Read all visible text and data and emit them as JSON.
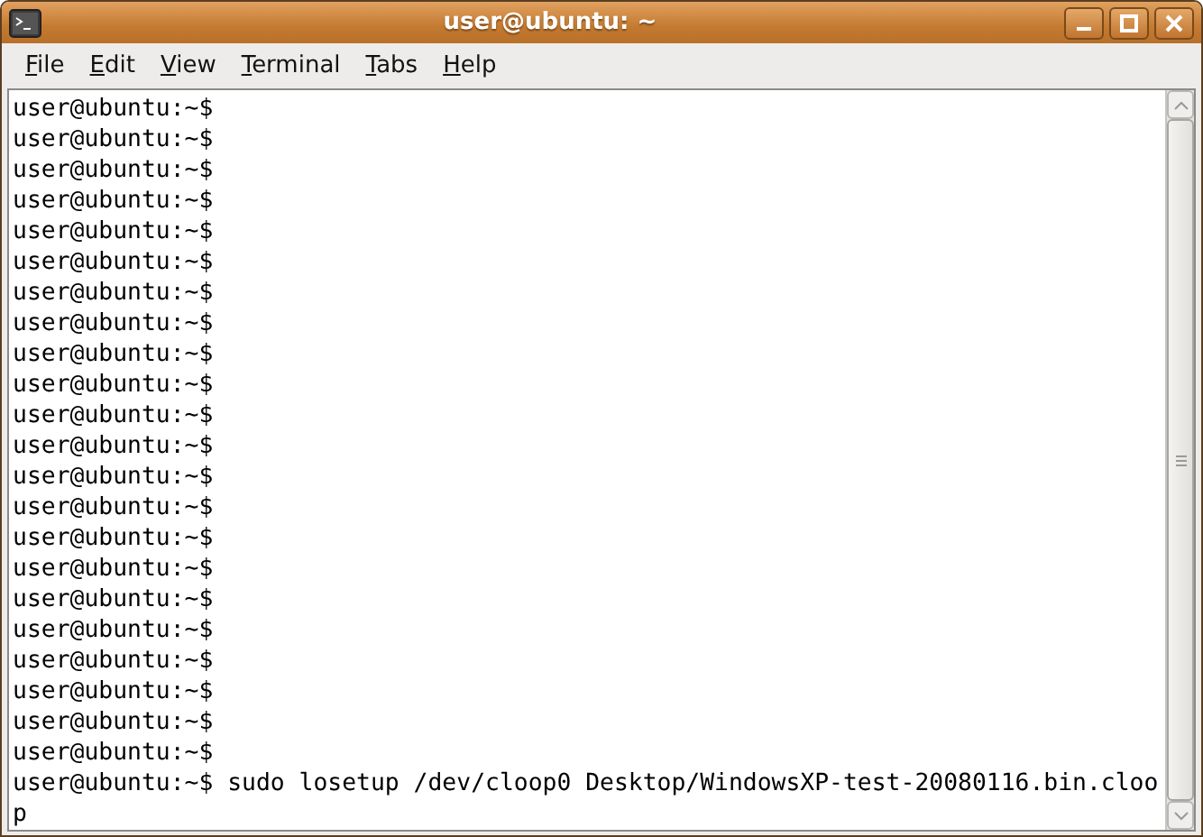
{
  "window": {
    "title": "user@ubuntu: ~"
  },
  "menu": [
    {
      "label": "File",
      "underlined": true
    },
    {
      "label": "Edit",
      "underlined": true
    },
    {
      "label": "View",
      "underlined": true
    },
    {
      "label": "Terminal",
      "underlined": true
    },
    {
      "label": "Tabs",
      "underlined": true
    },
    {
      "label": "Help",
      "underlined": true
    }
  ],
  "terminal": {
    "lines": [
      "user@ubuntu:~$",
      "user@ubuntu:~$",
      "user@ubuntu:~$",
      "user@ubuntu:~$",
      "user@ubuntu:~$",
      "user@ubuntu:~$",
      "user@ubuntu:~$",
      "user@ubuntu:~$",
      "user@ubuntu:~$",
      "user@ubuntu:~$",
      "user@ubuntu:~$",
      "user@ubuntu:~$",
      "user@ubuntu:~$",
      "user@ubuntu:~$",
      "user@ubuntu:~$",
      "user@ubuntu:~$",
      "user@ubuntu:~$",
      "user@ubuntu:~$",
      "user@ubuntu:~$",
      "user@ubuntu:~$",
      "user@ubuntu:~$",
      "user@ubuntu:~$",
      "user@ubuntu:~$ sudo losetup /dev/cloop0 Desktop/WindowsXP-test-20080116.bin.cloo",
      "p"
    ]
  }
}
